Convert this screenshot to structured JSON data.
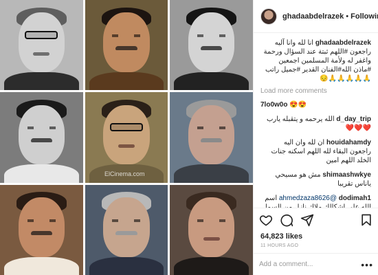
{
  "post": {
    "author": "ghadaabdelrazek",
    "follow_label": "Following",
    "separator": "•",
    "caption": "انا لله وانا آليه راجعون #اللهم ثبتة عند السؤال ورحمة واغفر له ولأمة المسلمين اجمعين #ماذن الله#الفنان القدير #جميل راتب 🙏🙏🙏🙏🙏😔",
    "load_more_label": "Load more comments",
    "likes": "64,823 likes",
    "time": "11 HOURS AGO",
    "add_comment_placeholder": "Add a comment...",
    "more_label": "•••",
    "watermark": "ElCinema.com"
  },
  "comments": [
    {
      "user": "7lo0w0o",
      "text": "😍😍"
    },
    {
      "user": "d_day_trip",
      "text": "الله يرحمه و يتقبله يارب ❤️❤️❤️"
    },
    {
      "user": "houidahamdy",
      "text": "ان لله وان اليه راجعون البقاء لله اللهم اسكنه جنات الخلد اللهم امين"
    },
    {
      "user": "shimaashwkye",
      "text": "مش هو مسيحي ياناس تقريبا"
    },
    {
      "user": "dodimah1",
      "mention": "@ahmedzaza8626",
      "text": "اسم الله علي اشكالك ملاك نازل من السما انا مش عارفة ان جايب البجاحة دي منين بتدعي علي واحدة مهما كانت مدنية بس هي ماذنكش ولا شرحتك مثلا ولا قتلتلك عيل من عيالك و كمان مش عايز حد يرد عليك لا بجج اوي بجد و بعدين ما يمكن الي شكلها دول انصف منك و من عيلتك"
    }
  ],
  "icons": [
    "heart-icon",
    "comment-icon",
    "share-icon",
    "bookmark-icon"
  ]
}
